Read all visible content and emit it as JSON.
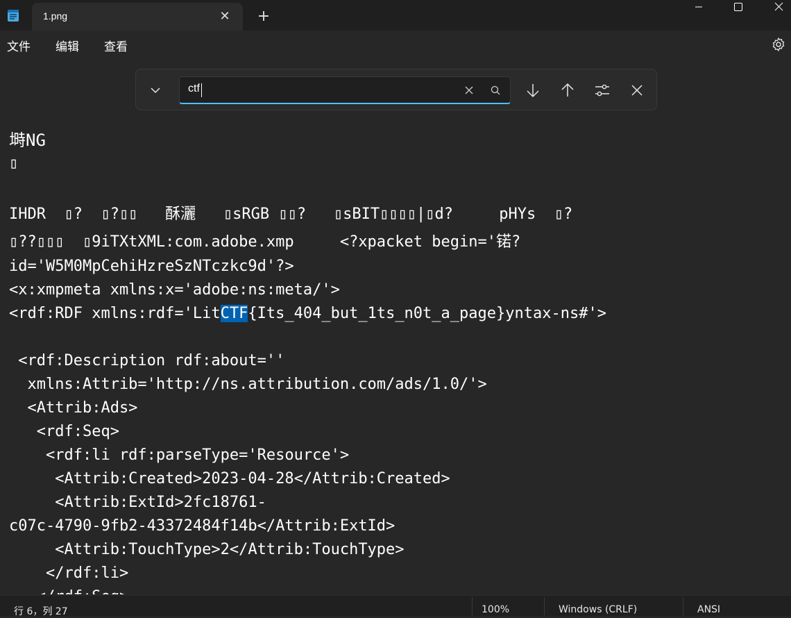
{
  "window": {
    "tab_title": "1.png",
    "tab_close_glyph": "✕",
    "new_tab_glyph": "+",
    "icons": [
      "notepad-icon",
      "close-icon",
      "plus-icon",
      "minimize-icon",
      "maximize-icon",
      "close-icon"
    ]
  },
  "menu": {
    "file": "文件",
    "edit": "编辑",
    "view": "查看",
    "settings_icon": "gear-icon"
  },
  "find": {
    "value": "ctf",
    "icons": [
      "chevron-down-icon",
      "clear-icon",
      "search-icon",
      "arrow-down-icon",
      "arrow-up-icon",
      "options-icon",
      "close-icon"
    ],
    "accent": "#4cc2ff"
  },
  "editor": {
    "highlight_color": "#0063b1",
    "lines": {
      "l1": "塒NG",
      "l2": "▯",
      "l3": "IHDR  ▯?  ▯?▯▯   酥灑   ▯sRGB ▯▯?   ▯sBIT▯▯▯▯|▯d?     pHYs  ▯?",
      "l4": "▯??▯▯▯  ▯9iTXtXML:com.adobe.xmp     <?xpacket begin='锘?",
      "l5": "id='W5M0MpCehiHzreSzNTczkc9d'?>",
      "l6": "<x:xmpmeta xmlns:x='adobe:ns:meta/'>",
      "l7_before": "<rdf:RDF xmlns:rdf='Lit",
      "l7_match": "CTF",
      "l7_after": "{Its_404_but_1ts_n0t_a_page}yntax-ns#'>",
      "l8": " <rdf:Description rdf:about=''",
      "l9": "  xmlns:Attrib='http://ns.attribution.com/ads/1.0/'>",
      "l10": "  <Attrib:Ads>",
      "l11": "   <rdf:Seq>",
      "l12": "    <rdf:li rdf:parseType='Resource'>",
      "l13": "     <Attrib:Created>2023-04-28</Attrib:Created>",
      "l14": "     <Attrib:ExtId>2fc18761-",
      "l15": "c07c-4790-9fb2-43372484f14b</Attrib:ExtId>",
      "l16": "     <Attrib:TouchType>2</Attrib:TouchType>",
      "l17": "    </rdf:li>",
      "l18": "   </rdf:Seq>"
    }
  },
  "status": {
    "position": "行 6，列 27",
    "zoom": "100%",
    "line_ending": "Windows (CRLF)",
    "encoding": "ANSI"
  }
}
